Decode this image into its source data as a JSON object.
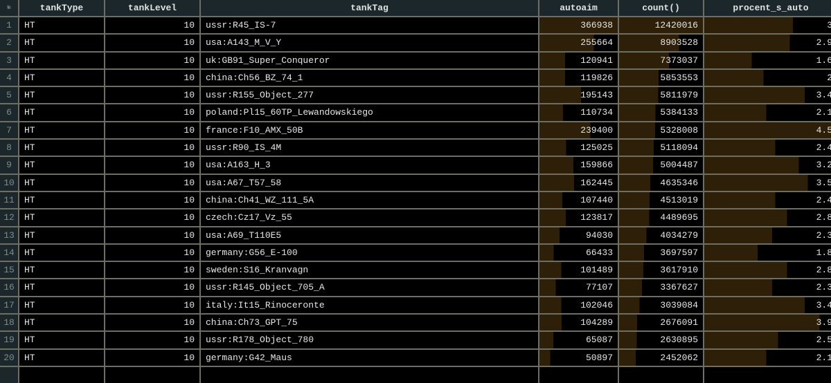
{
  "columns": [
    "№",
    "tankType",
    "tankLevel",
    "tankTag",
    "autoaim",
    "count()",
    "procent_s_auto"
  ],
  "bar_color": "#2e1f08",
  "header_bg": "#1c272c",
  "rows": [
    [
      "1",
      "HT",
      "10",
      "ussr:R45_IS-7",
      "366938",
      "12420016",
      "3"
    ],
    [
      "2",
      "HT",
      "10",
      "usa:A143_M_V_Y",
      "255664",
      "8903528",
      "2.9"
    ],
    [
      "3",
      "HT",
      "10",
      "uk:GB91_Super_Conqueror",
      "120941",
      "7373037",
      "1.6"
    ],
    [
      "4",
      "HT",
      "10",
      "china:Ch56_BZ_74_1",
      "119826",
      "5853553",
      "2"
    ],
    [
      "5",
      "HT",
      "10",
      "ussr:R155_Object_277",
      "195143",
      "5811979",
      "3.4"
    ],
    [
      "6",
      "HT",
      "10",
      "poland:Pl15_60TP_Lewandowskiego",
      "110734",
      "5384133",
      "2.1"
    ],
    [
      "7",
      "HT",
      "10",
      "france:F10_AMX_50B",
      "239400",
      "5328008",
      "4.5"
    ],
    [
      "8",
      "HT",
      "10",
      "ussr:R90_IS_4M",
      "125025",
      "5118094",
      "2.4"
    ],
    [
      "9",
      "HT",
      "10",
      "usa:A163_H_3",
      "159866",
      "5004487",
      "3.2"
    ],
    [
      "10",
      "HT",
      "10",
      "usa:A67_T57_58",
      "162445",
      "4635346",
      "3.5"
    ],
    [
      "11",
      "HT",
      "10",
      "china:Ch41_WZ_111_5A",
      "107440",
      "4513019",
      "2.4"
    ],
    [
      "12",
      "HT",
      "10",
      "czech:Cz17_Vz_55",
      "123817",
      "4489695",
      "2.8"
    ],
    [
      "13",
      "HT",
      "10",
      "usa:A69_T110E5",
      "94030",
      "4034279",
      "2.3"
    ],
    [
      "14",
      "HT",
      "10",
      "germany:G56_E-100",
      "66433",
      "3697597",
      "1.8"
    ],
    [
      "15",
      "HT",
      "10",
      "sweden:S16_Kranvagn",
      "101489",
      "3617910",
      "2.8"
    ],
    [
      "16",
      "HT",
      "10",
      "ussr:R145_Object_705_A",
      "77107",
      "3367627",
      "2.3"
    ],
    [
      "17",
      "HT",
      "10",
      "italy:It15_Rinoceronte",
      "102046",
      "3039084",
      "3.4"
    ],
    [
      "18",
      "HT",
      "10",
      "china:Ch73_GPT_75",
      "104289",
      "2676091",
      "3.9"
    ],
    [
      "19",
      "HT",
      "10",
      "ussr:R178_Object_780",
      "65087",
      "2630895",
      "2.5"
    ],
    [
      "20",
      "HT",
      "10",
      "germany:G42_Maus",
      "50897",
      "2452062",
      "2.1"
    ]
  ]
}
